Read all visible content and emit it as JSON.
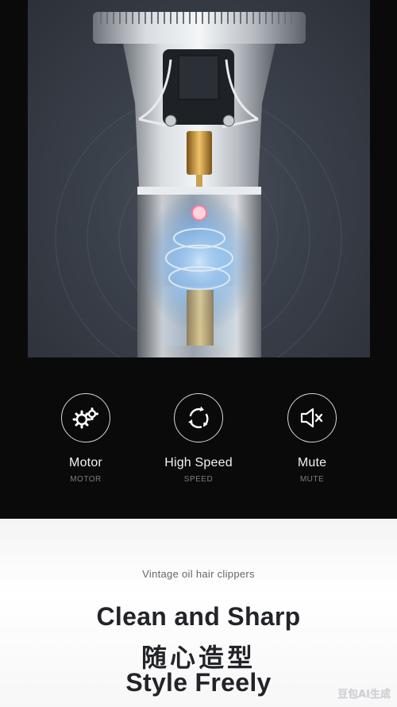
{
  "features": [
    {
      "title": "Motor",
      "subtitle": "MOTOR",
      "icon": "gears-icon"
    },
    {
      "title": "High Speed",
      "subtitle": "SPEED",
      "icon": "rotation-arrows-icon"
    },
    {
      "title": "Mute",
      "subtitle": "MUTE",
      "icon": "speaker-mute-icon"
    }
  ],
  "bottom": {
    "tagline": "Vintage oil hair clippers",
    "headline_1": "Clean and Sharp",
    "headline_2": "随心造型",
    "headline_3": "Style Freely"
  },
  "watermark": "豆包AI生成",
  "colors": {
    "hero_bg": "#3a4049",
    "page_bg": "#0a0a0b",
    "panel_bg": "#ffffff",
    "glow": "#6fb8ff"
  }
}
